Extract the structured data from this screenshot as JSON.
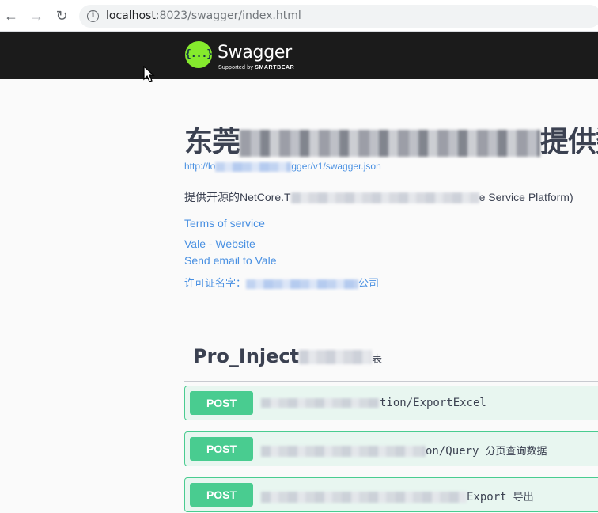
{
  "browser": {
    "url_host": "localhost",
    "url_rest": ":8023/swagger/index.html"
  },
  "topbar": {
    "logo_mark": "{...}",
    "brand": "Swagger",
    "supported_by": "Supported by",
    "smartbear": "SMARTBEAR"
  },
  "info": {
    "title_start": "东莞",
    "title_end": "提供数",
    "json_url_start": "http://lo",
    "json_url_end": "gger/v1/swagger.json",
    "description_start": "提供开源的NetCore.T",
    "description_end": "e Service Platform)",
    "terms": "Terms of service",
    "website": "Vale - Website",
    "email": "Send email to Vale",
    "license_start": "许可证名字：",
    "license_end": "公司"
  },
  "tag": {
    "name_start": "Pro_Inject",
    "name_end": "表"
  },
  "operations": [
    {
      "method": "POST",
      "path": "tion/ExportExcel",
      "summary": ""
    },
    {
      "method": "POST",
      "path": "on/Query",
      "summary": "分页查询数据"
    },
    {
      "method": "POST",
      "path": "Export",
      "summary": "导出"
    }
  ],
  "colors": {
    "topbar": "#1b1b1b",
    "logo": "#85ea2d",
    "link": "#4990e2",
    "post": "#49cc90",
    "post_bg": "#e8f6f0"
  }
}
